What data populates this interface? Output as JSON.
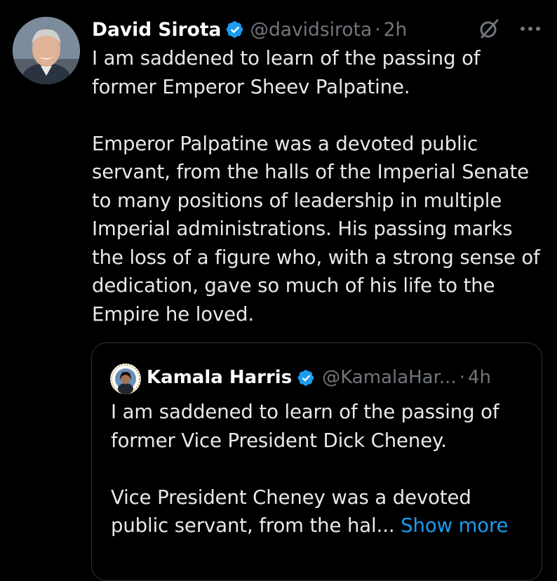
{
  "tweet": {
    "author_name": "David Sirota",
    "handle": "@davidsirota",
    "separator": "·",
    "time": "2h",
    "paragraphs": [
      "I am saddened to learn of the passing of former Emperor Sheev Palpatine.",
      "Emperor Palpatine was a devoted public servant, from the halls of the Imperial Senate to many positions of leadership in multiple Imperial administrations. His passing marks the loss of a figure who, with a strong sense of dedication, gave so much of his life to the Empire he loved."
    ],
    "icons": {
      "verified": "verified-badge-icon",
      "grok": "grok-icon",
      "more": "more-icon"
    }
  },
  "quote": {
    "author_name": "Kamala Harris",
    "handle": "@KamalaHar...",
    "separator": "·",
    "time": "4h",
    "paragraph_1": "I am saddened to learn of the passing of former Vice President Dick Cheney.",
    "paragraph_2": "Vice President Cheney was a devoted public servant, from the hal...",
    "show_more": "Show more"
  },
  "colors": {
    "background": "#000000",
    "text": "#e7e9ea",
    "muted": "#71767b",
    "accent": "#1d9bf0",
    "border": "#2f3336"
  }
}
